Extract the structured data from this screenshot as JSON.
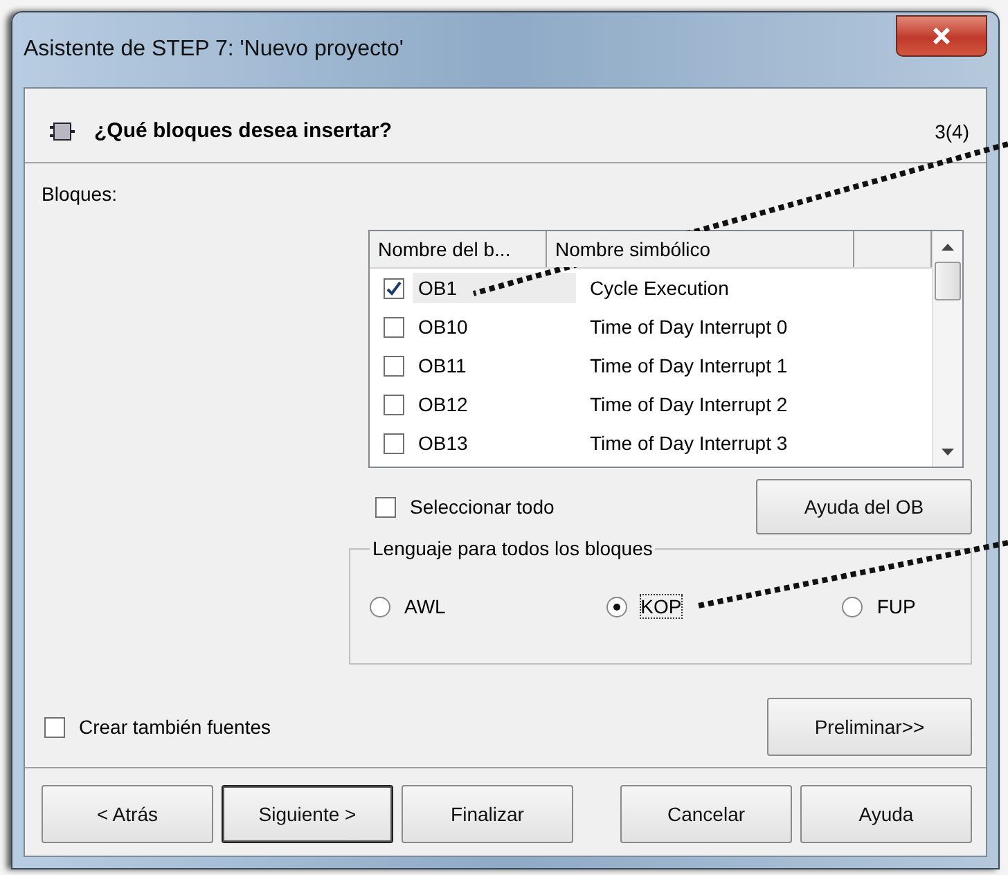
{
  "window": {
    "title": "Asistente de STEP 7: 'Nuevo proyecto'"
  },
  "header": {
    "title": "¿Qué bloques desea insertar?",
    "step": "3(4)"
  },
  "blocks_label": "Bloques:",
  "table": {
    "columns": [
      "Nombre del b...",
      "Nombre simbólico"
    ],
    "rows": [
      {
        "name": "OB1",
        "symbol": "Cycle Execution",
        "checked": true,
        "selected": true
      },
      {
        "name": "OB10",
        "symbol": "Time of Day Interrupt 0",
        "checked": false,
        "selected": false
      },
      {
        "name": "OB11",
        "symbol": "Time of Day Interrupt 1",
        "checked": false,
        "selected": false
      },
      {
        "name": "OB12",
        "symbol": "Time of Day Interrupt 2",
        "checked": false,
        "selected": false
      },
      {
        "name": "OB13",
        "symbol": "Time of Day Interrupt 3",
        "checked": false,
        "selected": false
      }
    ]
  },
  "select_all": {
    "label": "Seleccionar todo",
    "checked": false
  },
  "ob_help_button": "Ayuda del OB",
  "language_group": {
    "legend": "Lenguaje para todos los bloques",
    "options": [
      {
        "label": "AWL",
        "selected": false
      },
      {
        "label": "KOP",
        "selected": true
      },
      {
        "label": "FUP",
        "selected": false
      }
    ]
  },
  "create_sources": {
    "label": "Crear también fuentes",
    "checked": false
  },
  "preview_button": "Preliminar>>",
  "nav_buttons": [
    {
      "label": "< Atrás",
      "default": false
    },
    {
      "label": "Siguiente >",
      "default": true
    },
    {
      "label": "Finalizar",
      "default": false
    }
  ],
  "dialog_buttons": [
    {
      "label": "Cancelar",
      "default": false
    },
    {
      "label": "Ayuda",
      "default": false
    }
  ]
}
